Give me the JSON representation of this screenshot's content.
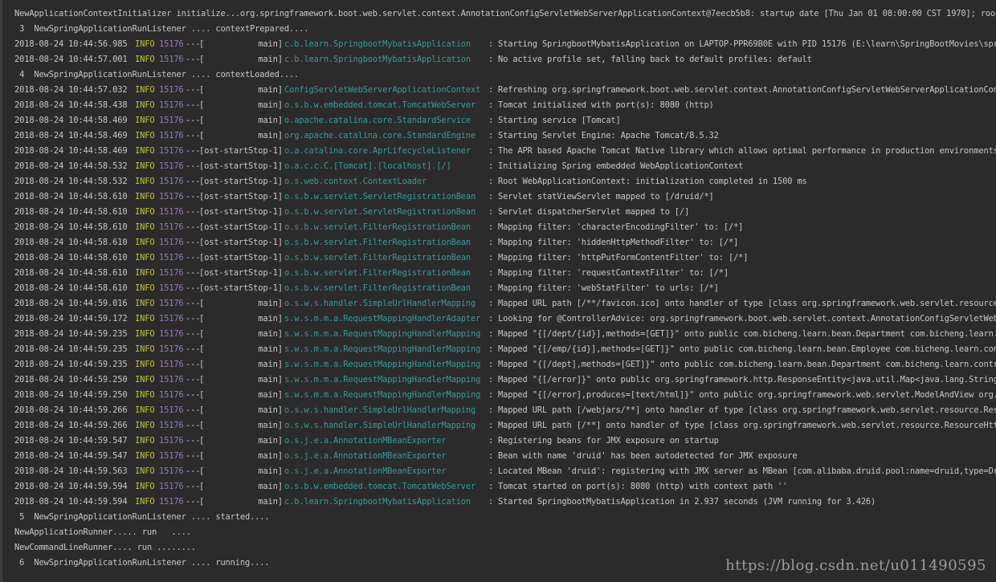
{
  "colors": {
    "background": "#2b2b2b",
    "text": "#c8c8c8",
    "level": "#c4c43a",
    "pid": "#9a79b3",
    "logger": "#3a9a9a"
  },
  "lines": [
    {
      "kind": "plain",
      "text": "NewApplicationContextInitializer initialize...org.springframework.boot.web.servlet.context.AnnotationConfigServletWebServerApplicationContext@7eecb5b8: startup date [Thu Jan 01 08:00:00 CST 1970]; root of"
    },
    {
      "kind": "plain",
      "text": " 3  NewSpringApplicationRunListener .... contextPrepared...."
    },
    {
      "kind": "log",
      "ts": "2018-08-24 10:44:56.985",
      "level": "INFO",
      "pid": "15176",
      "sep": "---",
      "thread": "[           main]",
      "logger": "c.b.learn.SpringbootMybatisApplication",
      "msg": "Starting SpringbootMybatisApplication on LAPTOP-PPR69B0E with PID 15176 (E:\\learn\\SpringBootMovies\\spri"
    },
    {
      "kind": "log",
      "ts": "2018-08-24 10:44:57.001",
      "level": "INFO",
      "pid": "15176",
      "sep": "---",
      "thread": "[           main]",
      "logger": "c.b.learn.SpringbootMybatisApplication",
      "msg": "No active profile set, falling back to default profiles: default"
    },
    {
      "kind": "plain",
      "text": " 4  NewSpringApplicationRunListener .... contextLoaded...."
    },
    {
      "kind": "log",
      "ts": "2018-08-24 10:44:57.032",
      "level": "INFO",
      "pid": "15176",
      "sep": "---",
      "thread": "[           main]",
      "logger": "ConfigServletWebServerApplicationContext",
      "msg": "Refreshing org.springframework.boot.web.servlet.context.AnnotationConfigServletWebServerApplicationCont"
    },
    {
      "kind": "log",
      "ts": "2018-08-24 10:44:58.438",
      "level": "INFO",
      "pid": "15176",
      "sep": "---",
      "thread": "[           main]",
      "logger": "o.s.b.w.embedded.tomcat.TomcatWebServer",
      "msg": "Tomcat initialized with port(s): 8080 (http)"
    },
    {
      "kind": "log",
      "ts": "2018-08-24 10:44:58.469",
      "level": "INFO",
      "pid": "15176",
      "sep": "---",
      "thread": "[           main]",
      "logger": "o.apache.catalina.core.StandardService",
      "msg": "Starting service [Tomcat]"
    },
    {
      "kind": "log",
      "ts": "2018-08-24 10:44:58.469",
      "level": "INFO",
      "pid": "15176",
      "sep": "---",
      "thread": "[           main]",
      "logger": "org.apache.catalina.core.StandardEngine",
      "msg": "Starting Servlet Engine: Apache Tomcat/8.5.32"
    },
    {
      "kind": "log",
      "ts": "2018-08-24 10:44:58.469",
      "level": "INFO",
      "pid": "15176",
      "sep": "---",
      "thread": "[ost-startStop-1]",
      "logger": "o.a.catalina.core.AprLifecycleListener",
      "msg": "The APR based Apache Tomcat Native library which allows optimal performance in production environments"
    },
    {
      "kind": "log",
      "ts": "2018-08-24 10:44:58.532",
      "level": "INFO",
      "pid": "15176",
      "sep": "---",
      "thread": "[ost-startStop-1]",
      "logger": "o.a.c.c.C.[Tomcat].[localhost].[/]",
      "msg": "Initializing Spring embedded WebApplicationContext"
    },
    {
      "kind": "log",
      "ts": "2018-08-24 10:44:58.532",
      "level": "INFO",
      "pid": "15176",
      "sep": "---",
      "thread": "[ost-startStop-1]",
      "logger": "o.s.web.context.ContextLoader",
      "msg": "Root WebApplicationContext: initialization completed in 1500 ms"
    },
    {
      "kind": "log",
      "ts": "2018-08-24 10:44:58.610",
      "level": "INFO",
      "pid": "15176",
      "sep": "---",
      "thread": "[ost-startStop-1]",
      "logger": "o.s.b.w.servlet.ServletRegistrationBean",
      "msg": "Servlet statViewServlet mapped to [/druid/*]"
    },
    {
      "kind": "log",
      "ts": "2018-08-24 10:44:58.610",
      "level": "INFO",
      "pid": "15176",
      "sep": "---",
      "thread": "[ost-startStop-1]",
      "logger": "o.s.b.w.servlet.ServletRegistrationBean",
      "msg": "Servlet dispatcherServlet mapped to [/]"
    },
    {
      "kind": "log",
      "ts": "2018-08-24 10:44:58.610",
      "level": "INFO",
      "pid": "15176",
      "sep": "---",
      "thread": "[ost-startStop-1]",
      "logger": "o.s.b.w.servlet.FilterRegistrationBean",
      "msg": "Mapping filter: 'characterEncodingFilter' to: [/*]"
    },
    {
      "kind": "log",
      "ts": "2018-08-24 10:44:58.610",
      "level": "INFO",
      "pid": "15176",
      "sep": "---",
      "thread": "[ost-startStop-1]",
      "logger": "o.s.b.w.servlet.FilterRegistrationBean",
      "msg": "Mapping filter: 'hiddenHttpMethodFilter' to: [/*]"
    },
    {
      "kind": "log",
      "ts": "2018-08-24 10:44:58.610",
      "level": "INFO",
      "pid": "15176",
      "sep": "---",
      "thread": "[ost-startStop-1]",
      "logger": "o.s.b.w.servlet.FilterRegistrationBean",
      "msg": "Mapping filter: 'httpPutFormContentFilter' to: [/*]"
    },
    {
      "kind": "log",
      "ts": "2018-08-24 10:44:58.610",
      "level": "INFO",
      "pid": "15176",
      "sep": "---",
      "thread": "[ost-startStop-1]",
      "logger": "o.s.b.w.servlet.FilterRegistrationBean",
      "msg": "Mapping filter: 'requestContextFilter' to: [/*]"
    },
    {
      "kind": "log",
      "ts": "2018-08-24 10:44:58.610",
      "level": "INFO",
      "pid": "15176",
      "sep": "---",
      "thread": "[ost-startStop-1]",
      "logger": "o.s.b.w.servlet.FilterRegistrationBean",
      "msg": "Mapping filter: 'webStatFilter' to urls: [/*]"
    },
    {
      "kind": "log",
      "ts": "2018-08-24 10:44:59.016",
      "level": "INFO",
      "pid": "15176",
      "sep": "---",
      "thread": "[           main]",
      "logger": "o.s.w.s.handler.SimpleUrlHandlerMapping",
      "msg": "Mapped URL path [/**/favicon.ico] onto handler of type [class org.springframework.web.servlet.resource."
    },
    {
      "kind": "log",
      "ts": "2018-08-24 10:44:59.172",
      "level": "INFO",
      "pid": "15176",
      "sep": "---",
      "thread": "[           main]",
      "logger": "s.w.s.m.m.a.RequestMappingHandlerAdapter",
      "msg": "Looking for @ControllerAdvice: org.springframework.boot.web.servlet.context.AnnotationConfigServletWebS"
    },
    {
      "kind": "log",
      "ts": "2018-08-24 10:44:59.235",
      "level": "INFO",
      "pid": "15176",
      "sep": "---",
      "thread": "[           main]",
      "logger": "s.w.s.m.m.a.RequestMappingHandlerMapping",
      "msg": "Mapped \"{[/dept/{id}],methods=[GET]}\" onto public com.bicheng.learn.bean.Department com.bicheng.learn.c"
    },
    {
      "kind": "log",
      "ts": "2018-08-24 10:44:59.235",
      "level": "INFO",
      "pid": "15176",
      "sep": "---",
      "thread": "[           main]",
      "logger": "s.w.s.m.m.a.RequestMappingHandlerMapping",
      "msg": "Mapped \"{[/emp/{id}],methods=[GET]}\" onto public com.bicheng.learn.bean.Employee com.bicheng.learn.cont"
    },
    {
      "kind": "log",
      "ts": "2018-08-24 10:44:59.235",
      "level": "INFO",
      "pid": "15176",
      "sep": "---",
      "thread": "[           main]",
      "logger": "s.w.s.m.m.a.RequestMappingHandlerMapping",
      "msg": "Mapped \"{[/dept],methods=[GET]}\" onto public com.bicheng.learn.bean.Department com.bicheng.learn.contro"
    },
    {
      "kind": "log",
      "ts": "2018-08-24 10:44:59.250",
      "level": "INFO",
      "pid": "15176",
      "sep": "---",
      "thread": "[           main]",
      "logger": "s.w.s.m.m.a.RequestMappingHandlerMapping",
      "msg": "Mapped \"{[/error]}\" onto public org.springframework.http.ResponseEntity<java.util.Map<java.lang.String,"
    },
    {
      "kind": "log",
      "ts": "2018-08-24 10:44:59.250",
      "level": "INFO",
      "pid": "15176",
      "sep": "---",
      "thread": "[           main]",
      "logger": "s.w.s.m.m.a.RequestMappingHandlerMapping",
      "msg": "Mapped \"{[/error],produces=[text/html]}\" onto public org.springframework.web.servlet.ModelAndView org.s"
    },
    {
      "kind": "log",
      "ts": "2018-08-24 10:44:59.266",
      "level": "INFO",
      "pid": "15176",
      "sep": "---",
      "thread": "[           main]",
      "logger": "o.s.w.s.handler.SimpleUrlHandlerMapping",
      "msg": "Mapped URL path [/webjars/**] onto handler of type [class org.springframework.web.servlet.resource.Reso"
    },
    {
      "kind": "log",
      "ts": "2018-08-24 10:44:59.266",
      "level": "INFO",
      "pid": "15176",
      "sep": "---",
      "thread": "[           main]",
      "logger": "o.s.w.s.handler.SimpleUrlHandlerMapping",
      "msg": "Mapped URL path [/**] onto handler of type [class org.springframework.web.servlet.resource.ResourceHttp"
    },
    {
      "kind": "log",
      "ts": "2018-08-24 10:44:59.547",
      "level": "INFO",
      "pid": "15176",
      "sep": "---",
      "thread": "[           main]",
      "logger": "o.s.j.e.a.AnnotationMBeanExporter",
      "msg": "Registering beans for JMX exposure on startup"
    },
    {
      "kind": "log",
      "ts": "2018-08-24 10:44:59.547",
      "level": "INFO",
      "pid": "15176",
      "sep": "---",
      "thread": "[           main]",
      "logger": "o.s.j.e.a.AnnotationMBeanExporter",
      "msg": "Bean with name 'druid' has been autodetected for JMX exposure"
    },
    {
      "kind": "log",
      "ts": "2018-08-24 10:44:59.563",
      "level": "INFO",
      "pid": "15176",
      "sep": "---",
      "thread": "[           main]",
      "logger": "o.s.j.e.a.AnnotationMBeanExporter",
      "msg": "Located MBean 'druid': registering with JMX server as MBean [com.alibaba.druid.pool:name=druid,type=Dru"
    },
    {
      "kind": "log",
      "ts": "2018-08-24 10:44:59.594",
      "level": "INFO",
      "pid": "15176",
      "sep": "---",
      "thread": "[           main]",
      "logger": "o.s.b.w.embedded.tomcat.TomcatWebServer",
      "msg": "Tomcat started on port(s): 8080 (http) with context path ''"
    },
    {
      "kind": "log",
      "ts": "2018-08-24 10:44:59.594",
      "level": "INFO",
      "pid": "15176",
      "sep": "---",
      "thread": "[           main]",
      "logger": "c.b.learn.SpringbootMybatisApplication",
      "msg": "Started SpringbootMybatisApplication in 2.937 seconds (JVM running for 3.426)"
    },
    {
      "kind": "plain",
      "text": " 5  NewSpringApplicationRunListener .... started...."
    },
    {
      "kind": "plain",
      "text": "NewApplicationRunner..... run   ...."
    },
    {
      "kind": "plain",
      "text": "NewCommandLineRunner.... run ........"
    },
    {
      "kind": "plain",
      "text": " 6  NewSpringApplicationRunListener .... running...."
    }
  ],
  "watermark": "https://blog.csdn.net/u011490595"
}
